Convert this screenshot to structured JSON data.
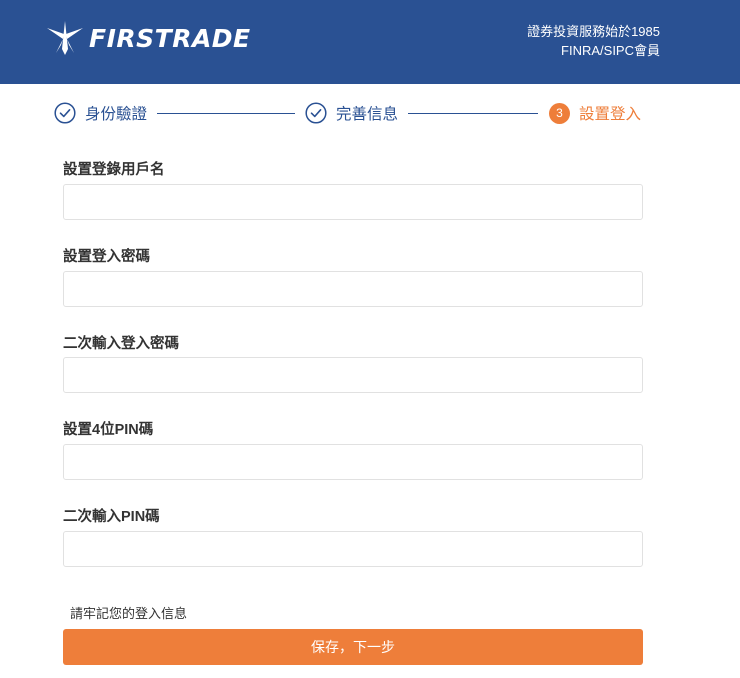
{
  "header": {
    "logo_text": "FIRSTRADE",
    "info_line1": "證券投資服務始於1985",
    "info_line2": "FINRA/SIPC會員",
    "brand_color": "#2a5193"
  },
  "stepper": {
    "steps": [
      {
        "label": "身份驗證",
        "status": "done",
        "icon": "check-circle-icon"
      },
      {
        "label": "完善信息",
        "status": "done",
        "icon": "check-circle-icon"
      },
      {
        "label": "設置登入",
        "status": "active",
        "number": "3"
      }
    ],
    "active_color": "#ee7e3a"
  },
  "form": {
    "fields": [
      {
        "label": "設置登錄用戶名",
        "value": "",
        "placeholder": ""
      },
      {
        "label": "設置登入密碼",
        "value": "",
        "placeholder": ""
      },
      {
        "label": "二次輸入登入密碼",
        "value": "",
        "placeholder": ""
      },
      {
        "label": "設置4位PIN碼",
        "value": "",
        "placeholder": ""
      },
      {
        "label": "二次輸入PIN碼",
        "value": "",
        "placeholder": ""
      }
    ],
    "reminder": "請牢記您的登入信息",
    "submit_label": "保存，下一步"
  }
}
